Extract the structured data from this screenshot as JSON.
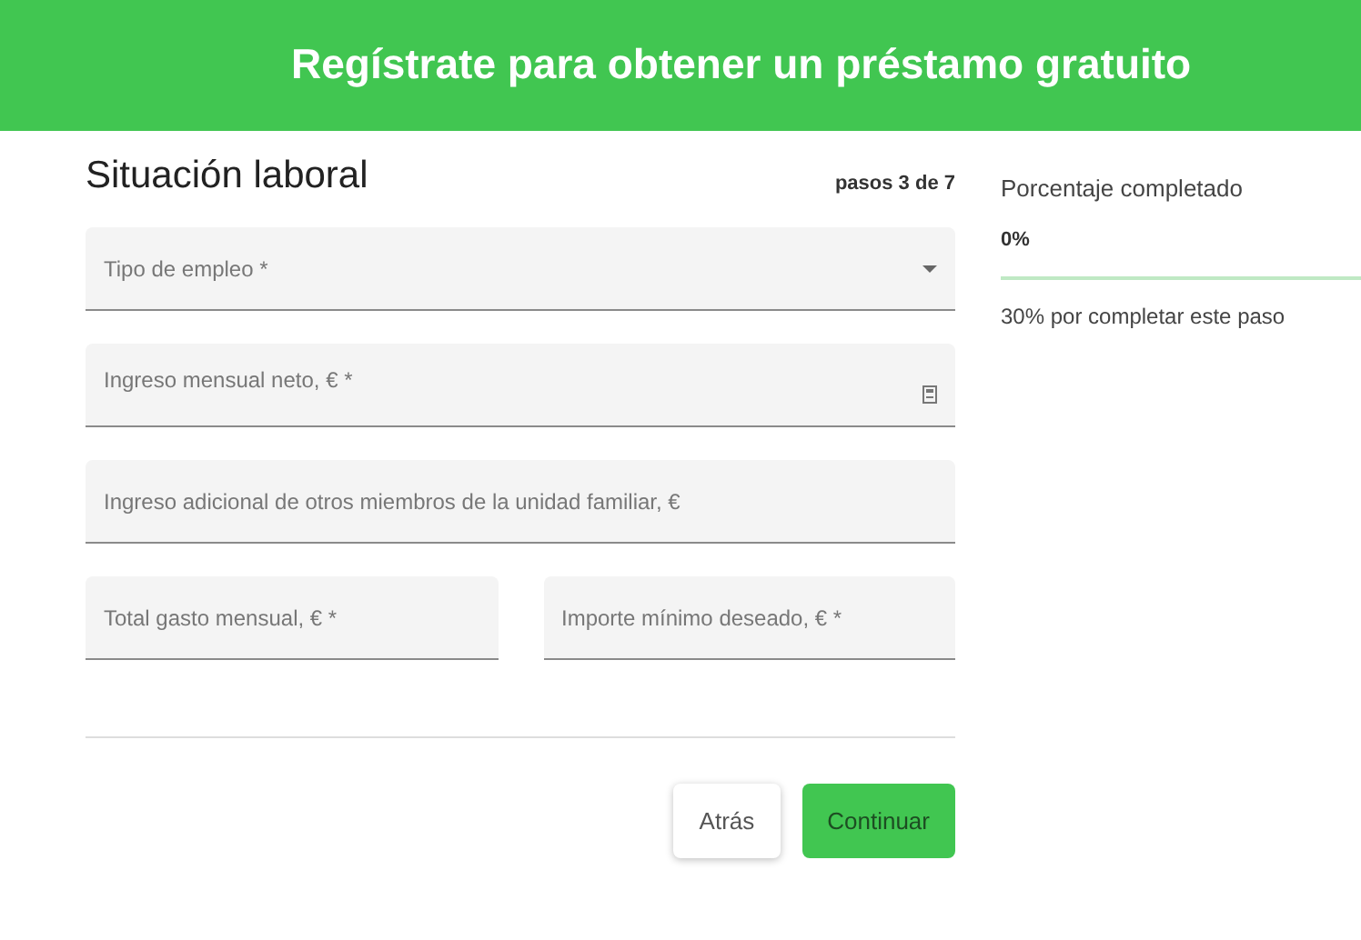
{
  "header": {
    "title": "Regístrate para obtener un préstamo gratuito"
  },
  "form": {
    "title": "Situación laboral",
    "step": "pasos 3 de 7",
    "rows": [
      {
        "fields": [
          {
            "kind": "select",
            "label": "Tipo de empleo *"
          }
        ]
      },
      {
        "fields": [
          {
            "kind": "calculator",
            "label": "Ingreso mensual neto, € *"
          }
        ]
      },
      {
        "fields": [
          {
            "kind": "text",
            "label": "Ingreso adicional de otros miembros de la unidad familiar, €"
          }
        ]
      },
      {
        "fields": [
          {
            "kind": "text",
            "label": "Total gasto mensual, € *"
          },
          {
            "kind": "text",
            "label": "Importe mínimo deseado, € *"
          }
        ]
      }
    ],
    "buttons": [
      {
        "kind": "secondary",
        "label": "Atrás"
      },
      {
        "kind": "primary",
        "label": "Continuar"
      }
    ]
  },
  "progress": {
    "title": "Porcentaje completado",
    "value": "0%",
    "level": 0,
    "note": "30% por completar este paso"
  }
}
